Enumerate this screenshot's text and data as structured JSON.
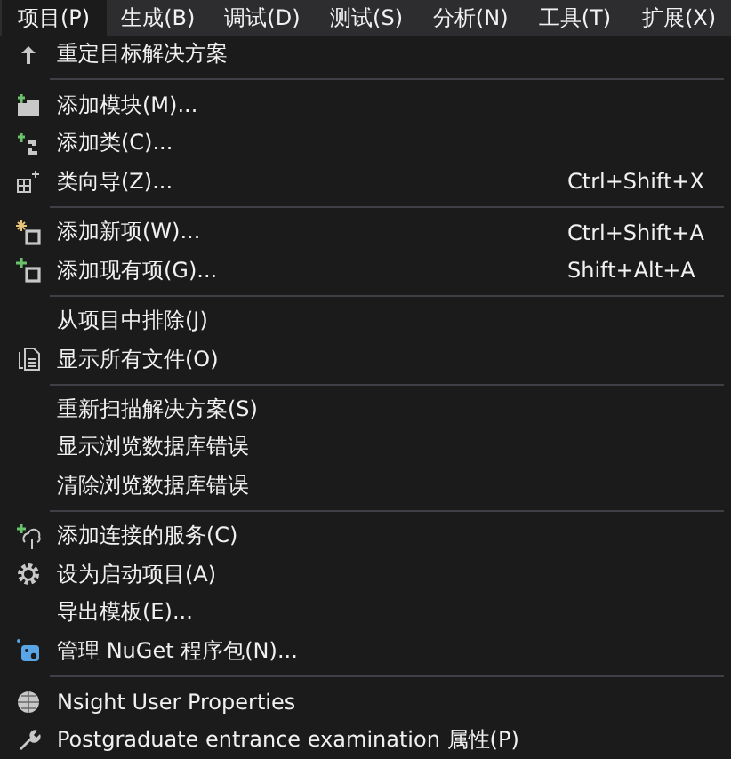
{
  "menu_bar": [
    {
      "label": "项目(P)",
      "selected": true
    },
    {
      "label": "生成(B)",
      "selected": false
    },
    {
      "label": "调试(D)",
      "selected": false
    },
    {
      "label": "测试(S)",
      "selected": false
    },
    {
      "label": "分析(N)",
      "selected": false
    },
    {
      "label": "工具(T)",
      "selected": false
    },
    {
      "label": "扩展(X)",
      "selected": false
    }
  ],
  "menu_items": [
    {
      "kind": "item",
      "label": "重定目标解决方案"
    },
    {
      "kind": "separator"
    },
    {
      "kind": "item",
      "label": "添加模块(M)..."
    },
    {
      "kind": "item",
      "label": "添加类(C)..."
    },
    {
      "kind": "item",
      "label": "类向导(Z)...",
      "shortcut": "Ctrl+Shift+X"
    },
    {
      "kind": "separator"
    },
    {
      "kind": "item",
      "label": "添加新项(W)...",
      "shortcut": "Ctrl+Shift+A"
    },
    {
      "kind": "item",
      "label": "添加现有项(G)...",
      "shortcut": "Shift+Alt+A"
    },
    {
      "kind": "separator"
    },
    {
      "kind": "item",
      "label": "从项目中排除(J)"
    },
    {
      "kind": "item",
      "label": "显示所有文件(O)"
    },
    {
      "kind": "separator"
    },
    {
      "kind": "item",
      "label": "重新扫描解决方案(S)"
    },
    {
      "kind": "item",
      "label": "显示浏览数据库错误"
    },
    {
      "kind": "item",
      "label": "清除浏览数据库错误"
    },
    {
      "kind": "separator"
    },
    {
      "kind": "item",
      "label": "添加连接的服务(C)"
    },
    {
      "kind": "item",
      "label": "设为启动项目(A)"
    },
    {
      "kind": "item",
      "label": "导出模板(E)..."
    },
    {
      "kind": "item",
      "label": "管理 NuGet 程序包(N)..."
    },
    {
      "kind": "separator"
    },
    {
      "kind": "item",
      "label": "Nsight User Properties"
    },
    {
      "kind": "item",
      "label": "Postgraduate entrance examination 属性(P)"
    }
  ]
}
